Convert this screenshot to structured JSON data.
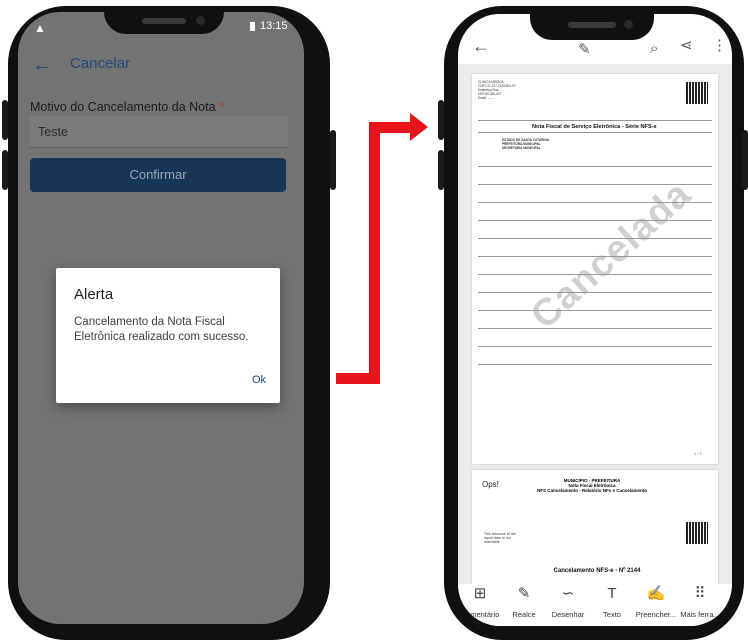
{
  "left_phone": {
    "status_time": "13:15",
    "status_icons": [
      "warning-icon",
      "battery-icon"
    ],
    "appbar": {
      "back": "←",
      "title": "Cancelar"
    },
    "form": {
      "label": "Motivo do Cancelamento da Nota",
      "required_mark": "*",
      "value": "Teste",
      "confirm_label": "Confirmar"
    },
    "dialog": {
      "title": "Alerta",
      "message": "Cancelamento da Nota Fiscal Eletrônica realizado com sucesso.",
      "ok_label": "Ok"
    },
    "colors": {
      "primary": "#1e4a7e",
      "button_bg": "#173656",
      "overlay": "#737373"
    }
  },
  "arrow_color": "#e8141c",
  "right_phone": {
    "toolbar_icons": [
      "back-arrow-icon",
      "pen-icon",
      "search-icon",
      "share-icon",
      "more-icon"
    ],
    "document": {
      "header_title": "Nota Fiscal de Serviço Eletrônica - Série NFS-e",
      "watermark": "Cancelada",
      "page_counter": "1 / 2",
      "page2_label": "Ops!",
      "page2_note": "This resource of the report item is not reachable.",
      "page2_title": "MUNICÍPIO - PREFEITURA",
      "page2_subtitle": "Nota Fiscal Eletrônica",
      "page2_report": "NFS Cancelamento - Relatório NFs e Cancelamento",
      "page2_band": "Cancelamento NFS-e - Nº 2144"
    },
    "tools": [
      {
        "label": "Comentário",
        "icon": "comment-icon",
        "glyph": "⊞"
      },
      {
        "label": "Realce",
        "icon": "highlight-icon",
        "glyph": "✎"
      },
      {
        "label": "Desenhar",
        "icon": "draw-icon",
        "glyph": "∽"
      },
      {
        "label": "Texto",
        "icon": "text-icon",
        "glyph": "T"
      },
      {
        "label": "Preencher...",
        "icon": "fill-sign-icon",
        "glyph": "✍"
      },
      {
        "label": "Mais ferra...",
        "icon": "more-tools-icon",
        "glyph": "⠿"
      }
    ]
  }
}
